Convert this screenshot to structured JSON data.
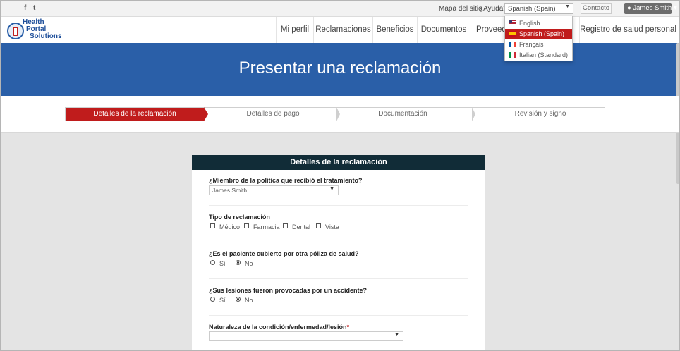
{
  "topbar": {
    "facebook_label": "f",
    "twitter_label": "t",
    "sitemap": "Mapa del sitio",
    "help": "¿Ayuda?",
    "language_selected": "Spanish (Spain)",
    "contact": "Contacto",
    "user": "James Smith"
  },
  "language_menu": {
    "items": [
      "English",
      "Spanish (Spain)",
      "Français",
      "Italian (Standard)"
    ],
    "selected_index": 1
  },
  "logo": {
    "line1": "Health",
    "line2": "Portal",
    "line3": "Solutions"
  },
  "nav": {
    "items": [
      "Mi perfil",
      "Reclamaciones",
      "Beneficios",
      "Documentos",
      "Proveedo",
      "Registro de salud personal"
    ]
  },
  "banner": {
    "title": "Presentar una reclamación"
  },
  "stepper": {
    "steps": [
      "Detalles de la reclamación",
      "Detalles de pago",
      "Documentación",
      "Revisión y signo"
    ],
    "active_index": 0
  },
  "form": {
    "heading": "Detalles de la reclamación",
    "member_question": "¿Miembro de la política que recibió el tratamiento?",
    "member_value": "James Smith",
    "claim_type_label": "Tipo de reclamación",
    "claim_types": [
      "Médico",
      "Farmacia",
      "Dental",
      "Vista"
    ],
    "other_policy_question": "¿Es el paciente cubierto por otra póliza de salud?",
    "other_policy_options": [
      "Sí",
      "No"
    ],
    "other_policy_selected": "No",
    "accident_question": "¿Sus lesiones fueron provocadas por un accidente?",
    "accident_options": [
      "Sí",
      "No"
    ],
    "accident_selected": "No",
    "condition_label": "Naturaleza de la condición/enfermedad/lesión",
    "condition_required_mark": "*",
    "condition_value": ""
  },
  "colors": {
    "brand_blue": "#2a5fa8",
    "accent_red": "#c01c1c",
    "card_header": "#112c37"
  }
}
